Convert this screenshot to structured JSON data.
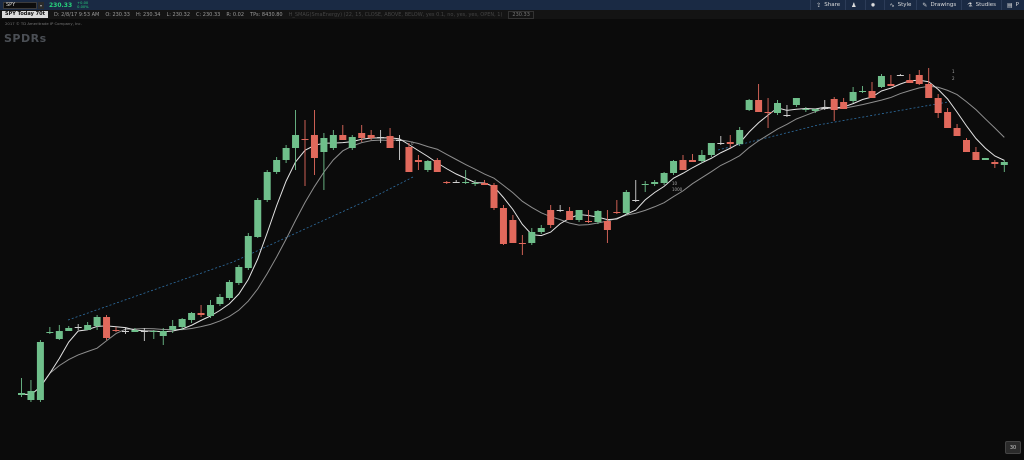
{
  "toolbar": {
    "symbol": "SPY",
    "last_price": "230.33",
    "change_top": "+0.00",
    "change_bottom": "0.00%",
    "buttons": [
      {
        "label": "Share",
        "icon": "share-icon"
      },
      {
        "label": "",
        "icon": "user-icon"
      },
      {
        "label": "",
        "icon": "gear-icon"
      },
      {
        "label": "Style",
        "icon": "style-icon"
      },
      {
        "label": "Drawings",
        "icon": "pencil-icon"
      },
      {
        "label": "Studies",
        "icon": "studies-icon"
      },
      {
        "label": "P",
        "icon": "panel-icon"
      }
    ]
  },
  "infobar": {
    "title": "SPY Today 70t",
    "date": "D: 2/8/17 9:53 AM",
    "open": "O: 230.33",
    "high": "H: 230.34",
    "low": "L: 230.32",
    "close": "C: 230.33",
    "range": "R: 0.02",
    "tps": "TPs: 8430.80",
    "study": "H_SMAG(SmaEnergy) (22, 15, CLOSE, ABOVE, BELOW, yes 0.1, no, yes, yes, OPEN, 1)",
    "last": "230.33"
  },
  "meta_line": "2017 © TD Ameritrade IP Company, Inc.",
  "logo_text": "SPDRs",
  "zoom_label": "30",
  "colors": {
    "up": "#6fbf8b",
    "down": "#e1695c",
    "fast_ma": "#e3e3e3",
    "slow_ma": "#8e8e8e",
    "trend": "#2f6fa3",
    "topbar": "#1a2a44"
  },
  "chart_data": {
    "type": "candlestick",
    "annotations": [
      "0",
      "1",
      "2",
      "10",
      "1000"
    ],
    "candles": [
      {
        "o": 395,
        "h": 397,
        "l": 378,
        "c": 393
      },
      {
        "o": 400,
        "h": 402,
        "l": 380,
        "c": 391
      },
      {
        "o": 400,
        "h": 402,
        "l": 340,
        "c": 342
      },
      {
        "o": 333,
        "h": 334,
        "l": 327,
        "c": 332
      },
      {
        "o": 339,
        "h": 340,
        "l": 325,
        "c": 331
      },
      {
        "o": 331,
        "h": 331,
        "l": 326,
        "c": 328
      },
      {
        "o": 327,
        "h": 330,
        "l": 324,
        "c": 327
      },
      {
        "o": 330,
        "h": 330,
        "l": 322,
        "c": 325
      },
      {
        "o": 326,
        "h": 330,
        "l": 315,
        "c": 317
      },
      {
        "o": 317,
        "h": 340,
        "l": 315,
        "c": 338
      },
      {
        "o": 330,
        "h": 332,
        "l": 327,
        "c": 331
      },
      {
        "o": 331,
        "h": 334,
        "l": 328,
        "c": 331
      },
      {
        "o": 332,
        "h": 332,
        "l": 328,
        "c": 330
      },
      {
        "o": 331,
        "h": 341,
        "l": 328,
        "c": 331
      },
      {
        "o": 332,
        "h": 339,
        "l": 330,
        "c": 331
      },
      {
        "o": 336,
        "h": 345,
        "l": 328,
        "c": 331
      },
      {
        "o": 330,
        "h": 333,
        "l": 320,
        "c": 326
      },
      {
        "o": 327,
        "h": 330,
        "l": 318,
        "c": 319
      },
      {
        "o": 320,
        "h": 323,
        "l": 312,
        "c": 313
      },
      {
        "o": 313,
        "h": 317,
        "l": 305,
        "c": 315
      },
      {
        "o": 316,
        "h": 318,
        "l": 300,
        "c": 305
      },
      {
        "o": 304,
        "h": 306,
        "l": 294,
        "c": 297
      },
      {
        "o": 298,
        "h": 300,
        "l": 280,
        "c": 282
      },
      {
        "o": 283,
        "h": 285,
        "l": 265,
        "c": 267
      },
      {
        "o": 268,
        "h": 270,
        "l": 233,
        "c": 236
      },
      {
        "o": 237,
        "h": 238,
        "l": 198,
        "c": 200
      },
      {
        "o": 200,
        "h": 202,
        "l": 170,
        "c": 172
      },
      {
        "o": 172,
        "h": 174,
        "l": 157,
        "c": 160
      },
      {
        "o": 160,
        "h": 163,
        "l": 145,
        "c": 148
      },
      {
        "o": 148,
        "h": 170,
        "l": 110,
        "c": 135
      },
      {
        "o": 139,
        "h": 186,
        "l": 120,
        "c": 140
      },
      {
        "o": 135,
        "h": 175,
        "l": 110,
        "c": 158
      },
      {
        "o": 152,
        "h": 190,
        "l": 133,
        "c": 138
      },
      {
        "o": 148,
        "h": 150,
        "l": 130,
        "c": 135
      },
      {
        "o": 135,
        "h": 138,
        "l": 125,
        "c": 140
      },
      {
        "o": 148,
        "h": 150,
        "l": 135,
        "c": 137
      },
      {
        "o": 133,
        "h": 142,
        "l": 125,
        "c": 138
      },
      {
        "o": 135,
        "h": 140,
        "l": 130,
        "c": 138
      },
      {
        "o": 137,
        "h": 143,
        "l": 130,
        "c": 137
      },
      {
        "o": 136,
        "h": 140,
        "l": 128,
        "c": 148
      },
      {
        "o": 140,
        "h": 160,
        "l": 135,
        "c": 140
      },
      {
        "o": 147,
        "h": 149,
        "l": 143,
        "c": 172
      },
      {
        "o": 160,
        "h": 170,
        "l": 155,
        "c": 162
      },
      {
        "o": 170,
        "h": 172,
        "l": 160,
        "c": 161
      },
      {
        "o": 160,
        "h": 172,
        "l": 158,
        "c": 172
      },
      {
        "o": 182,
        "h": 184,
        "l": 181,
        "c": 183
      },
      {
        "o": 182,
        "h": 183,
        "l": 180,
        "c": 182
      },
      {
        "o": 183,
        "h": 184,
        "l": 170,
        "c": 182
      },
      {
        "o": 184,
        "h": 186,
        "l": 180,
        "c": 183
      },
      {
        "o": 183,
        "h": 185,
        "l": 180,
        "c": 185
      },
      {
        "o": 185,
        "h": 210,
        "l": 183,
        "c": 208
      },
      {
        "o": 208,
        "h": 245,
        "l": 205,
        "c": 244
      },
      {
        "o": 220,
        "h": 240,
        "l": 215,
        "c": 243
      },
      {
        "o": 243,
        "h": 255,
        "l": 235,
        "c": 244
      },
      {
        "o": 243,
        "h": 245,
        "l": 228,
        "c": 232
      },
      {
        "o": 232,
        "h": 234,
        "l": 225,
        "c": 228
      },
      {
        "o": 210,
        "h": 228,
        "l": 205,
        "c": 225
      },
      {
        "o": 210,
        "h": 212,
        "l": 205,
        "c": 210
      },
      {
        "o": 211,
        "h": 220,
        "l": 207,
        "c": 220
      },
      {
        "o": 220,
        "h": 222,
        "l": 210,
        "c": 210
      },
      {
        "o": 221,
        "h": 223,
        "l": 210,
        "c": 222
      },
      {
        "o": 222,
        "h": 224,
        "l": 210,
        "c": 211
      },
      {
        "o": 221,
        "h": 243,
        "l": 210,
        "c": 230
      },
      {
        "o": 212,
        "h": 214,
        "l": 200,
        "c": 213
      },
      {
        "o": 213,
        "h": 215,
        "l": 190,
        "c": 192
      },
      {
        "o": 200,
        "h": 202,
        "l": 180,
        "c": 200
      },
      {
        "o": 185,
        "h": 192,
        "l": 181,
        "c": 184
      },
      {
        "o": 184,
        "h": 186,
        "l": 180,
        "c": 182
      },
      {
        "o": 183,
        "h": 185,
        "l": 172,
        "c": 173
      },
      {
        "o": 173,
        "h": 175,
        "l": 160,
        "c": 161
      },
      {
        "o": 160,
        "h": 170,
        "l": 155,
        "c": 170
      },
      {
        "o": 160,
        "h": 162,
        "l": 154,
        "c": 162
      },
      {
        "o": 161,
        "h": 163,
        "l": 150,
        "c": 155
      },
      {
        "o": 155,
        "h": 157,
        "l": 144,
        "c": 143
      },
      {
        "o": 143,
        "h": 145,
        "l": 136,
        "c": 143
      },
      {
        "o": 142,
        "h": 148,
        "l": 135,
        "c": 144
      },
      {
        "o": 144,
        "h": 146,
        "l": 127,
        "c": 130
      },
      {
        "o": 110,
        "h": 111,
        "l": 99,
        "c": 100
      },
      {
        "o": 100,
        "h": 101,
        "l": 84,
        "c": 112
      },
      {
        "o": 112,
        "h": 128,
        "l": 98,
        "c": 113
      },
      {
        "o": 113,
        "h": 115,
        "l": 100,
        "c": 103
      },
      {
        "o": 115,
        "h": 117,
        "l": 105,
        "c": 115
      },
      {
        "o": 105,
        "h": 107,
        "l": 98,
        "c": 98
      },
      {
        "o": 110,
        "h": 112,
        "l": 107,
        "c": 109
      },
      {
        "o": 111,
        "h": 113,
        "l": 109,
        "c": 109
      },
      {
        "o": 108,
        "h": 110,
        "l": 100,
        "c": 108
      },
      {
        "o": 99,
        "h": 121,
        "l": 97,
        "c": 110
      },
      {
        "o": 102,
        "h": 104,
        "l": 98,
        "c": 109
      },
      {
        "o": 101,
        "h": 103,
        "l": 87,
        "c": 92
      },
      {
        "o": 92,
        "h": 93,
        "l": 86,
        "c": 91
      },
      {
        "o": 91,
        "h": 95,
        "l": 82,
        "c": 98
      },
      {
        "o": 87,
        "h": 88,
        "l": 74,
        "c": 76
      },
      {
        "o": 84,
        "h": 86,
        "l": 75,
        "c": 86
      },
      {
        "o": 75,
        "h": 76,
        "l": 74,
        "c": 75
      },
      {
        "o": 80,
        "h": 82,
        "l": 74,
        "c": 83
      },
      {
        "o": 75,
        "h": 85,
        "l": 70,
        "c": 84
      },
      {
        "o": 84,
        "h": 88,
        "l": 68,
        "c": 98
      },
      {
        "o": 98,
        "h": 118,
        "l": 94,
        "c": 113
      },
      {
        "o": 112,
        "h": 125,
        "l": 108,
        "c": 128
      },
      {
        "o": 128,
        "h": 131,
        "l": 124,
        "c": 136
      },
      {
        "o": 140,
        "h": 142,
        "l": 138,
        "c": 152
      },
      {
        "o": 152,
        "h": 156,
        "l": 147,
        "c": 160
      },
      {
        "o": 160,
        "h": 162,
        "l": 162,
        "c": 158
      },
      {
        "o": 162,
        "h": 168,
        "l": 160,
        "c": 164
      },
      {
        "o": 165,
        "h": 172,
        "l": 160,
        "c": 162
      }
    ],
    "fast_ma_label": "",
    "slow_ma_label": ""
  }
}
